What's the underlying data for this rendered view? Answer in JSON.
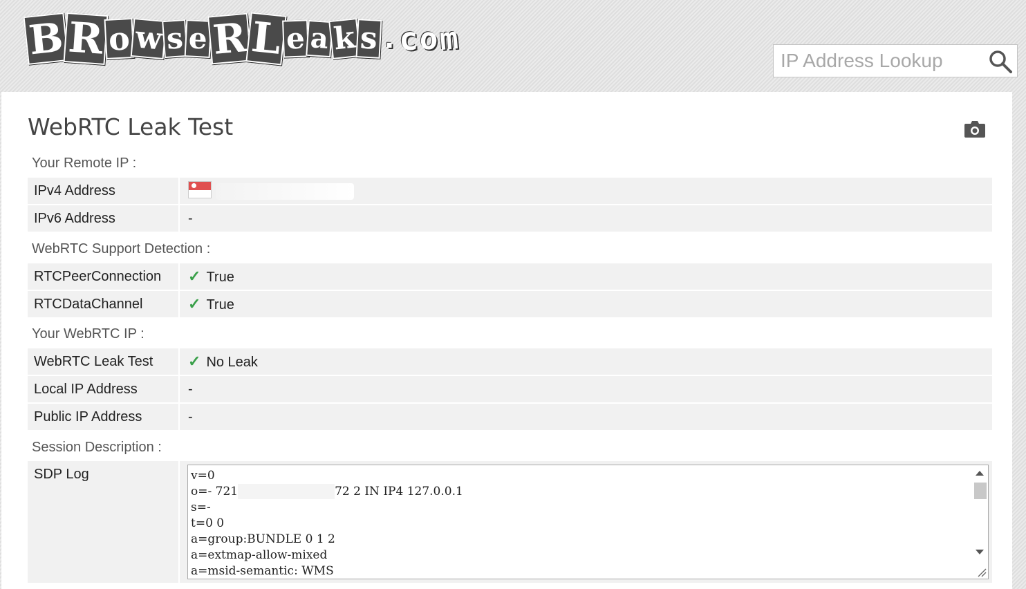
{
  "header": {
    "logo_text": "BRowseRLeaks.com",
    "logo_tiles": [
      "B",
      "R",
      "o",
      "w",
      "s",
      "e",
      "R",
      "L",
      "e",
      "a",
      "k",
      "s",
      ".",
      "c",
      "o",
      "m"
    ],
    "search_placeholder": "IP Address Lookup"
  },
  "page": {
    "title": "WebRTC Leak Test"
  },
  "sections": {
    "remote_ip": "Your Remote IP :",
    "support": "WebRTC Support Detection :",
    "webrtc_ip": "Your WebRTC IP :",
    "session": "Session Description :"
  },
  "rows": {
    "ipv4_key": "IPv4 Address",
    "ipv6_key": "IPv6 Address",
    "ipv6_val": "-",
    "rtcpeer_key": "RTCPeerConnection",
    "rtcpeer_val": "True",
    "rtcdata_key": "RTCDataChannel",
    "rtcdata_val": "True",
    "leak_key": "WebRTC Leak Test",
    "leak_val": "No Leak",
    "local_key": "Local IP Address",
    "local_val": "-",
    "public_key": "Public IP Address",
    "public_val": "-",
    "sdp_key": "SDP Log"
  },
  "sdp_log": {
    "line1": "v=0",
    "line2_a": "o=- 721",
    "line2_b": "72 2 IN IP4 127.0.0.1",
    "line3": "s=-",
    "line4": "t=0 0",
    "line5": "a=group:BUNDLE 0 1 2",
    "line6": "a=extmap-allow-mixed",
    "line7": "a=msid-semantic: WMS"
  },
  "colors": {
    "check": "#3aa04a",
    "row_bg": "#f1f1f1",
    "title": "#444444"
  },
  "icons": {
    "search": "search-icon",
    "camera": "camera-icon",
    "check": "check-icon",
    "flag": "flag-icon"
  }
}
